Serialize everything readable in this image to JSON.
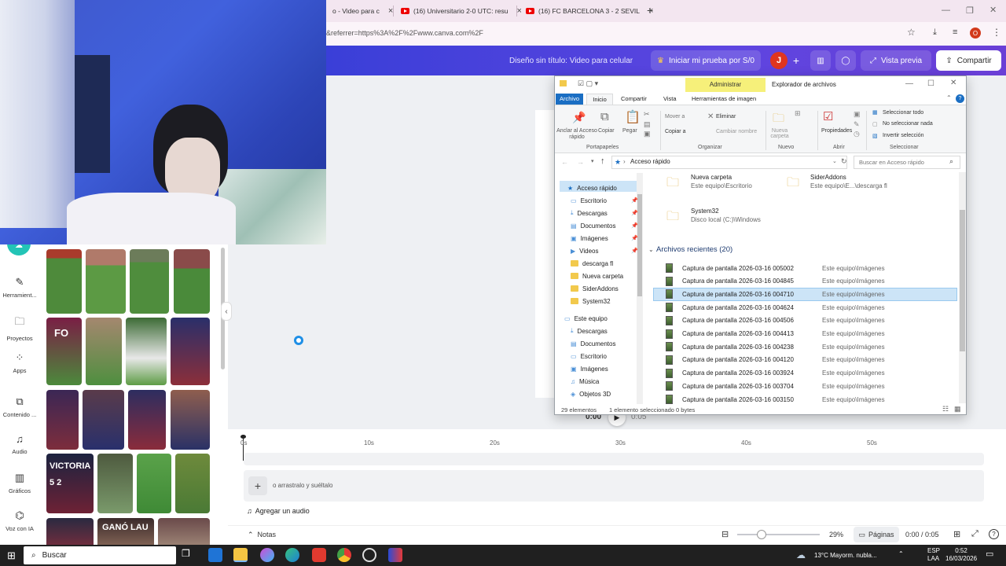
{
  "browser": {
    "tabs": [
      {
        "label": "o - Video para c"
      },
      {
        "label": "(16) Universitario 2-0 UTC: resu"
      },
      {
        "label": "(16) FC BARCELONA 3 - 2 SEVIL"
      }
    ],
    "new_tab": "+",
    "url": "&referrer=https%3A%2F%2Fwww.canva.com%2F",
    "profile_initial": "O"
  },
  "canva": {
    "design_title": "Diseño sin título: Video para celular",
    "trial_button": "Iniciar mi prueba por S/0",
    "user_initial": "J",
    "preview_button": "Vista previa",
    "share_button": "Compartir"
  },
  "sidebar": {
    "items": [
      {
        "label": "Herramient..."
      },
      {
        "label": "Proyectos"
      },
      {
        "label": "Apps"
      },
      {
        "label": "Contenido ..."
      },
      {
        "label": "Audio"
      },
      {
        "label": "Gráficos"
      },
      {
        "label": "Voz con IA"
      }
    ]
  },
  "panel": {
    "thumbs": [
      {
        "overlay": ""
      },
      {
        "overlay": ""
      },
      {
        "overlay": ""
      },
      {
        "overlay": ""
      },
      {
        "overlay": "FO"
      },
      {
        "overlay": ""
      },
      {
        "overlay": ""
      },
      {
        "overlay": ""
      },
      {
        "overlay": ""
      },
      {
        "overlay": ""
      },
      {
        "overlay": ""
      },
      {
        "overlay": ""
      },
      {
        "overlay": "VICTORIA 5 2"
      },
      {
        "overlay": ""
      },
      {
        "overlay": ""
      },
      {
        "overlay": ""
      },
      {
        "overlay": ""
      },
      {
        "overlay": "GANÓ LAU"
      },
      {
        "overlay": ""
      }
    ]
  },
  "timeline": {
    "ticks": [
      "0s",
      "10s",
      "20s",
      "30s",
      "40s",
      "50s"
    ],
    "current_time": "0:00",
    "total_time": "0:05",
    "drop_hint": "o arrastralo y suéltalo",
    "add_audio": "Agregar un audio",
    "notes": "Notas",
    "zoom": "29%",
    "pages": "Páginas",
    "time_display": "0:00 / 0:05"
  },
  "explorer": {
    "context_tab": "Administrar",
    "window_title": "Explorador de archivos",
    "ribbon_tabs": [
      "Archivo",
      "Inicio",
      "Compartir",
      "Vista",
      "Herramientas de imagen"
    ],
    "ribbon": {
      "anclar": "Anclar al Acceso rápido",
      "copiar": "Copiar",
      "pegar": "Pegar",
      "portapapeles": "Portapapeles",
      "mover": "Mover a",
      "copiar_a": "Copiar a",
      "eliminar": "Eliminar",
      "cambiar": "Cambiar nombre",
      "organizar": "Organizar",
      "nueva_carpeta": "Nueva carpeta",
      "nuevo": "Nuevo",
      "propiedades": "Propiedades",
      "abrir": "Abrir",
      "sel_todo": "Seleccionar todo",
      "no_sel": "No seleccionar nada",
      "invertir": "Invertir selección",
      "seleccionar": "Seleccionar"
    },
    "breadcrumb": "Acceso rápido",
    "search_placeholder": "Buscar en Acceso rápido",
    "nav": [
      {
        "label": "Acceso rápido"
      },
      {
        "label": "Escritorio"
      },
      {
        "label": "Descargas"
      },
      {
        "label": "Documentos"
      },
      {
        "label": "Imágenes"
      },
      {
        "label": "Videos"
      },
      {
        "label": "descarga fl"
      },
      {
        "label": "Nueva carpeta"
      },
      {
        "label": "SiderAddons"
      },
      {
        "label": "System32"
      },
      {
        "label": "Este equipo"
      },
      {
        "label": "Descargas"
      },
      {
        "label": "Documentos"
      },
      {
        "label": "Escritorio"
      },
      {
        "label": "Imágenes"
      },
      {
        "label": "Música"
      },
      {
        "label": "Objetos 3D"
      }
    ],
    "frequent": [
      {
        "name": "Nueva carpeta",
        "path": "Este equipo\\Escritorio"
      },
      {
        "name": "SiderAddons",
        "path": "Este equipo\\E...\\descarga fl"
      },
      {
        "name": "System32",
        "path": "Disco local (C:)\\Windows"
      }
    ],
    "recent_header": "Archivos recientes (20)",
    "recent": [
      {
        "name": "Captura de pantalla 2026-03-16 005002",
        "location": "Este equipo\\Imágenes"
      },
      {
        "name": "Captura de pantalla 2026-03-16 004845",
        "location": "Este equipo\\Imágenes"
      },
      {
        "name": "Captura de pantalla 2026-03-16 004710",
        "location": "Este equipo\\Imágenes"
      },
      {
        "name": "Captura de pantalla 2026-03-16 004624",
        "location": "Este equipo\\Imágenes"
      },
      {
        "name": "Captura de pantalla 2026-03-16 004506",
        "location": "Este equipo\\Imágenes"
      },
      {
        "name": "Captura de pantalla 2026-03-16 004413",
        "location": "Este equipo\\Imágenes"
      },
      {
        "name": "Captura de pantalla 2026-03-16 004238",
        "location": "Este equipo\\Imágenes"
      },
      {
        "name": "Captura de pantalla 2026-03-16 004120",
        "location": "Este equipo\\Imágenes"
      },
      {
        "name": "Captura de pantalla 2026-03-16 003924",
        "location": "Este equipo\\Imágenes"
      },
      {
        "name": "Captura de pantalla 2026-03-16 003704",
        "location": "Este equipo\\Imágenes"
      },
      {
        "name": "Captura de pantalla 2026-03-16 003150",
        "location": "Este equipo\\Imágenes"
      }
    ],
    "status_count": "29 elementos",
    "status_selected": "1 elemento seleccionado  0 bytes"
  },
  "taskbar": {
    "search": "Buscar",
    "weather": "13°C  Mayorm. nubla...",
    "lang1": "ESP",
    "lang2": "LAA",
    "time": "0:52",
    "date": "16/03/2026"
  }
}
